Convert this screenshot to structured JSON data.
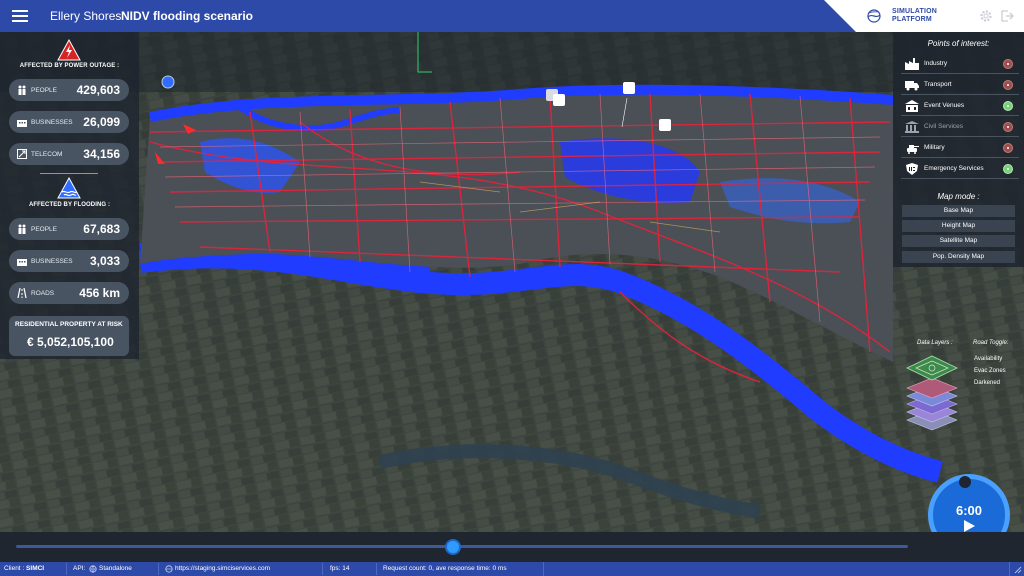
{
  "header": {
    "city": "Ellery Shores",
    "scenario": "NIDV flooding scenario",
    "brand_line1": "SIMULATION",
    "brand_line2": "PLATFORM"
  },
  "power_outage": {
    "title": "AFFECTED BY POWER OUTAGE :",
    "stats": [
      {
        "label": "PEOPLE",
        "value": "429,603",
        "icon": "people-icon"
      },
      {
        "label": "BUSINESSES",
        "value": "26,099",
        "icon": "building-icon"
      },
      {
        "label": "TELECOM",
        "value": "34,156",
        "icon": "telecom-icon"
      }
    ]
  },
  "flooding": {
    "title": "AFFECTED BY FLOODING :",
    "stats": [
      {
        "label": "PEOPLE",
        "value": "67,683",
        "icon": "people-icon"
      },
      {
        "label": "BUSINESSES",
        "value": "3,033",
        "icon": "building-icon"
      },
      {
        "label": "ROADS",
        "value": "456 km",
        "icon": "road-icon"
      }
    ]
  },
  "residential": {
    "label": "RESIDENTIAL PROPERTY AT RISK",
    "value": "€ 5,052,105,100"
  },
  "poi": {
    "title": "Points of interest:",
    "items": [
      {
        "label": "Industry",
        "enabled": false,
        "icon": "factory-icon"
      },
      {
        "label": "Transport",
        "enabled": false,
        "icon": "truck-icon"
      },
      {
        "label": "Event Venues",
        "enabled": true,
        "icon": "venue-icon"
      },
      {
        "label": "Civil Services",
        "enabled": false,
        "icon": "civil-services-icon"
      },
      {
        "label": "Military",
        "enabled": false,
        "icon": "military-icon"
      },
      {
        "label": "Emergency Services",
        "enabled": true,
        "icon": "emergency-112-icon"
      }
    ]
  },
  "map_mode": {
    "title": "Map mode :",
    "options": [
      "Base Map",
      "Height Map",
      "Satellite Map",
      "Pop. Density Map"
    ]
  },
  "layers": {
    "data_layers_title": "Data Layers :",
    "road_toggle_title": "Road Toggle:",
    "road_options": [
      "Availability",
      "Evac Zones",
      "Darkened"
    ]
  },
  "playback": {
    "time": "6:00",
    "progress": 0.49
  },
  "status": {
    "client_label": "Client : ",
    "client_value": "SIMCI",
    "api_label": "API:",
    "api_value": "Standalone",
    "url": "https://staging.simciservices.com",
    "fps": "fps: 14",
    "request": "Request count: 0, ave response time: 0 ms"
  },
  "colors": {
    "header": "#2e4aa8",
    "flood": "#1f3cff",
    "roads": "#e8223a",
    "accent": "#2f9bff"
  }
}
